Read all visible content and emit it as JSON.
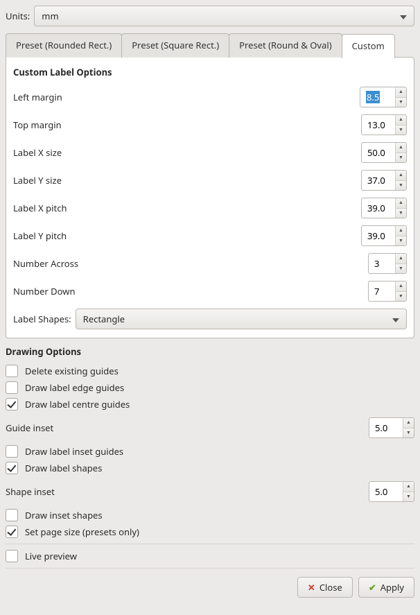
{
  "units": {
    "label": "Units:",
    "value": "mm"
  },
  "tabs": {
    "preset_rounded": "Preset (Rounded Rect.)",
    "preset_square": "Preset (Square Rect.)",
    "preset_round_oval": "Preset (Round & Oval)",
    "custom": "Custom"
  },
  "custom": {
    "title": "Custom Label Options",
    "left_margin": {
      "label": "Left margin",
      "value": "8.5"
    },
    "top_margin": {
      "label": "Top margin",
      "value": "13.0"
    },
    "label_x_size": {
      "label": "Label X size",
      "value": "50.0"
    },
    "label_y_size": {
      "label": "Label Y size",
      "value": "37.0"
    },
    "label_x_pitch": {
      "label": "Label X pitch",
      "value": "39.0"
    },
    "label_y_pitch": {
      "label": "Label Y pitch",
      "value": "39.0"
    },
    "number_across": {
      "label": "Number Across",
      "value": "3"
    },
    "number_down": {
      "label": "Number Down",
      "value": "7"
    },
    "label_shapes": {
      "label": "Label Shapes:",
      "value": "Rectangle"
    }
  },
  "drawing": {
    "title": "Drawing Options",
    "delete_guides": "Delete existing guides",
    "edge_guides": "Draw label edge guides",
    "centre_guides": "Draw label centre guides",
    "guide_inset": {
      "label": "Guide inset",
      "value": "5.0"
    },
    "inset_guides": "Draw label inset guides",
    "label_shapes": "Draw label shapes",
    "shape_inset": {
      "label": "Shape inset",
      "value": "5.0"
    },
    "inset_shapes": "Draw inset shapes",
    "set_page_size": "Set page size (presets only)"
  },
  "preview": {
    "live": "Live preview"
  },
  "buttons": {
    "close": "Close",
    "apply": "Apply"
  }
}
